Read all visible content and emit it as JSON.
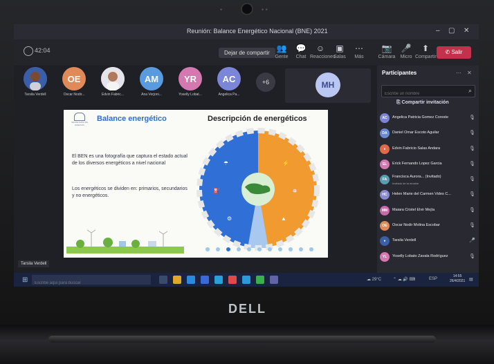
{
  "window": {
    "title": "Reunión: Balance Energético Nacional (BNE) 2021",
    "minimize": "–",
    "maximize": "▢",
    "close": "✕"
  },
  "toolbar": {
    "elapsed": "42:04",
    "stop_sharing_label": "Dejar de compartir",
    "buttons": [
      {
        "label": "Gente",
        "icon": "people-icon"
      },
      {
        "label": "Chat",
        "icon": "chat-icon"
      },
      {
        "label": "Reacciones",
        "icon": "reactions-icon"
      },
      {
        "label": "Salas",
        "icon": "rooms-icon"
      },
      {
        "label": "Más",
        "icon": "more-icon"
      },
      {
        "label": "Cámara",
        "icon": "camera-icon"
      },
      {
        "label": "Micro",
        "icon": "mic-icon"
      },
      {
        "label": "Compartir",
        "icon": "share-icon"
      }
    ],
    "leave_label": "Salir",
    "colors": {
      "leave": "#c4314b"
    }
  },
  "strip": {
    "participants": [
      {
        "initials": "",
        "name": "Tarsila Verdell",
        "color": "#3a5fa8",
        "photo": true
      },
      {
        "initials": "OE",
        "name": "Oscar Nodir...",
        "color": "#e08a5a"
      },
      {
        "initials": "",
        "name": "Edvin Fabric...",
        "color": "#d8d8dc",
        "photo": true
      },
      {
        "initials": "AM",
        "name": "Ana Verjoni...",
        "color": "#5a9be0"
      },
      {
        "initials": "YR",
        "name": "Yoselly Lobat...",
        "color": "#d478b0"
      },
      {
        "initials": "AC",
        "name": "Angelica Pa...",
        "color": "#7c86d8"
      }
    ],
    "more": "+6",
    "spotlight_initials": "MH"
  },
  "slide": {
    "left_title": "Balance energético",
    "right_title": "Descripción de energéticos",
    "logo_text": "SECRETARÍA DE ENERGÍA",
    "paragraph1": "El BEN es una fotografía que captura el estado actual de los diversos energéticos a nivel nacional",
    "paragraph2": "Los energéticos se dividen en: primarios, secundarios y no energéticos.",
    "colors": {
      "primary_half": "#2f6fd6",
      "secondary_half": "#f09a30",
      "title_blue": "#2c6fcf"
    }
  },
  "presenter_label": "Tarsila Verdell",
  "panel": {
    "title": "Participantes",
    "search_placeholder": "Escribe un nombre",
    "share_invite": "Compartir invitación",
    "participants": [
      {
        "initials": "AC",
        "name": "Angelica Patricia Gomez Coreste",
        "color": "#7c86d8",
        "status": ""
      },
      {
        "initials": "DA",
        "name": "Daniel Omar Escoto Aguilar",
        "color": "#6a8ad8",
        "status": ""
      },
      {
        "initials": "",
        "name": "Edvin Fabricio Salas Andara",
        "color": "#e06a4a",
        "status": "",
        "photo": true
      },
      {
        "initials": "EL",
        "name": "Erick Fernando Lopez Garcia",
        "color": "#d478b0",
        "status": ""
      },
      {
        "initials": "FA",
        "name": "Francisca Aurora... (Invitado)",
        "color": "#5a9bb0",
        "status": "Invitado de la reunión"
      },
      {
        "initials": "HC",
        "name": "Helen Marie del Carmen Vides C...",
        "color": "#8a8ad0",
        "status": ""
      },
      {
        "initials": "MM",
        "name": "Maiara Cristel Elvir Mejía",
        "color": "#c76aa8",
        "status": ""
      },
      {
        "initials": "OE",
        "name": "Oscar Nodir Molina Escobar",
        "color": "#e08a5a",
        "status": ""
      },
      {
        "initials": "",
        "name": "Tarsila Verdell",
        "color": "#3a5fa8",
        "status": "",
        "photo": true
      },
      {
        "initials": "YL",
        "name": "Yoselly Lobato Zavala Rodríguez",
        "color": "#d478b0",
        "status": ""
      }
    ]
  },
  "taskbar": {
    "search_placeholder": "Escribe aquí para buscar",
    "weather": "29°C",
    "lang": "ESP",
    "time": "14:55",
    "date": "26/4/2021"
  },
  "laptop": {
    "brand": "DELL"
  }
}
